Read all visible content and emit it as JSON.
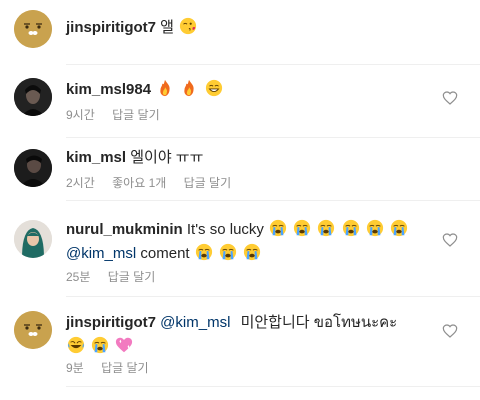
{
  "comments": [
    {
      "username": "jinspiritigot7",
      "text": "앨",
      "emojis_line1": [
        "kiss-wink"
      ],
      "meta": []
    },
    {
      "username": "kim_msl984",
      "text": "",
      "emojis_line1": [
        "fire",
        "fire",
        "grin"
      ],
      "meta": [
        "9시간",
        "답글 달기"
      ]
    },
    {
      "username": "kim_msl",
      "text": "엘이야 ㅠㅠ",
      "meta": [
        "2시간",
        "좋아요 1개",
        "답글 달기"
      ]
    },
    {
      "username": "nurul_mukminin",
      "text": "It's so lucky",
      "emojis_line1": [
        "cry",
        "cry",
        "cry",
        "cry",
        "cry",
        "cry"
      ],
      "line2_mention": "@kim_msl",
      "line2_text": "coment",
      "emojis_line2": [
        "cry",
        "cry",
        "cry"
      ],
      "meta": [
        "25분",
        "답글 달기"
      ]
    },
    {
      "username": "jinspiritigot7",
      "mention": "@kim_msl",
      "text": "미안합니다 ขอโทษนะคะ",
      "emojis_line2": [
        "joy",
        "cry",
        "heart-sparkle"
      ],
      "meta": [
        "9분",
        "답글 달기"
      ]
    }
  ]
}
